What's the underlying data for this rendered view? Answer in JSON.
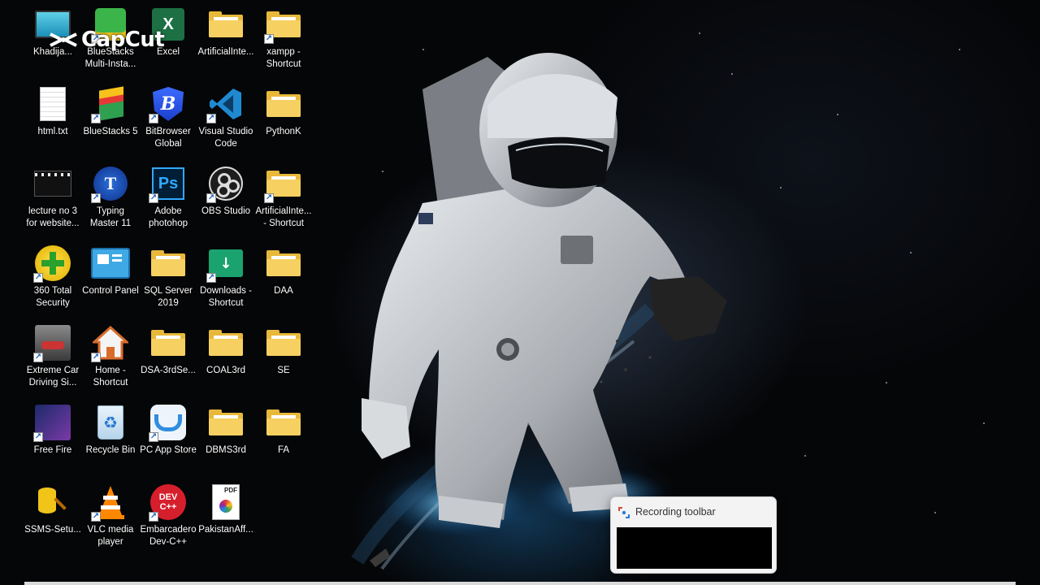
{
  "overlay": {
    "watermark": "CapCut"
  },
  "desktop_icons": [
    {
      "label": "Khadija...",
      "icon": "monitor-icon",
      "shortcut": false
    },
    {
      "label": "BlueStacks\nMulti-Insta...",
      "icon": "bluestacks-multi-icon",
      "shortcut": true
    },
    {
      "label": "Excel",
      "icon": "excel-icon",
      "shortcut": false
    },
    {
      "label": "ArtificialInte...",
      "icon": "folder-icon",
      "shortcut": false
    },
    {
      "label": "xampp -\nShortcut",
      "icon": "folder-icon",
      "shortcut": true
    },
    {
      "label": "html.txt",
      "icon": "text-file-icon",
      "shortcut": false
    },
    {
      "label": "BlueStacks 5",
      "icon": "bluestacks-icon",
      "shortcut": true
    },
    {
      "label": "BitBrowser\nGlobal",
      "icon": "bitbrowser-icon",
      "shortcut": true
    },
    {
      "label": "Visual Studio\nCode",
      "icon": "vscode-icon",
      "shortcut": true
    },
    {
      "label": "PythonK",
      "icon": "folder-icon",
      "shortcut": false
    },
    {
      "label": "lecture no 3\nfor website...",
      "icon": "video-file-icon",
      "shortcut": false
    },
    {
      "label": "Typing\nMaster 11",
      "icon": "typing-master-icon",
      "shortcut": true
    },
    {
      "label": "Adobe\nphotohop",
      "icon": "photoshop-icon",
      "shortcut": true
    },
    {
      "label": "OBS Studio",
      "icon": "obs-icon",
      "shortcut": true
    },
    {
      "label": "ArtificialInte...\n- Shortcut",
      "icon": "folder-icon",
      "shortcut": true
    },
    {
      "label": "360 Total\nSecurity",
      "icon": "security-360-icon",
      "shortcut": true
    },
    {
      "label": "Control Panel",
      "icon": "control-panel-icon",
      "shortcut": false
    },
    {
      "label": "SQL Server\n2019",
      "icon": "folder-icon",
      "shortcut": false
    },
    {
      "label": "Downloads -\nShortcut",
      "icon": "downloads-folder-icon",
      "shortcut": true
    },
    {
      "label": "DAA",
      "icon": "folder-icon",
      "shortcut": false
    },
    {
      "label": "Extreme Car\nDriving Si...",
      "icon": "car-game-icon",
      "shortcut": true
    },
    {
      "label": "Home -\nShortcut",
      "icon": "home-icon",
      "shortcut": true
    },
    {
      "label": "DSA-3rdSe...",
      "icon": "folder-icon",
      "shortcut": false
    },
    {
      "label": "COAL3rd",
      "icon": "folder-icon",
      "shortcut": false
    },
    {
      "label": "SE",
      "icon": "folder-icon",
      "shortcut": false
    },
    {
      "label": "Free Fire",
      "icon": "free-fire-icon",
      "shortcut": true
    },
    {
      "label": "Recycle Bin",
      "icon": "recycle-bin-icon",
      "shortcut": false
    },
    {
      "label": "PC App Store",
      "icon": "app-store-icon",
      "shortcut": true
    },
    {
      "label": "DBMS3rd",
      "icon": "folder-icon",
      "shortcut": false
    },
    {
      "label": "FA",
      "icon": "folder-icon",
      "shortcut": false
    },
    {
      "label": "SSMS-Setu...",
      "icon": "ssms-setup-icon",
      "shortcut": false
    },
    {
      "label": "VLC media\nplayer",
      "icon": "vlc-icon",
      "shortcut": true
    },
    {
      "label": "Embarcadero\nDev-C++",
      "icon": "devcpp-icon",
      "shortcut": true
    },
    {
      "label": "PakistanAff...",
      "icon": "pdf-file-icon",
      "shortcut": false
    }
  ],
  "recording_toolbar": {
    "title": "Recording toolbar"
  },
  "icon_text": {
    "ps": "Ps",
    "pdf": "PDF",
    "dev": "DEV",
    "cpp": "C++",
    "excel": "X"
  }
}
